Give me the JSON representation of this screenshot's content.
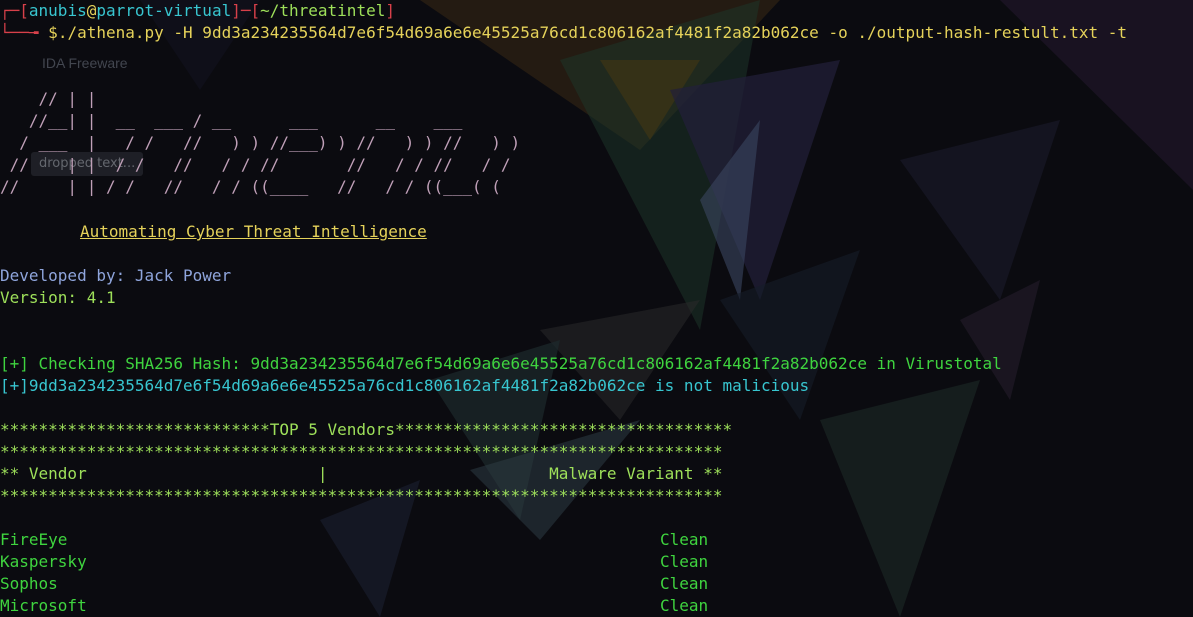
{
  "prompt": {
    "user": "anubis",
    "at": "@",
    "host": "parrot-virtual",
    "directory": "~/threatintel",
    "dollar": "$",
    "command": "./athena.py -H 9dd3a234235564d7e6f54d69a6e6e45525a76cd1c806162af4481f2a82b062ce -o ./output-hash-restult.txt -t"
  },
  "background_windows": {
    "ida_label": "IDA Freeware",
    "dropped_label": "dropped text..."
  },
  "banner": {
    "ascii_lines": [
      "    // | |",
      "   //__| |  __  ___ / __      ___      __    ___",
      "  / ___  |   / /   //   ) ) //___) ) //   ) ) //   ) )",
      " //    | |  / /   //   / / //       //   / / //   / /",
      "//     | | / /   //   / / ((____   //   / / ((___( ("
    ],
    "tagline": "Automating Cyber Threat Intelligence",
    "developer": "Developed by: Jack Power",
    "version": "Version: 4.1"
  },
  "results": {
    "checking": "[+] Checking SHA256 Hash: 9dd3a234235564d7e6f54d69a6e6e45525a76cd1c806162af4481f2a82b062ce in Virustotal",
    "verdict": "[+]9dd3a234235564d7e6f54d69a6e6e45525a76cd1c806162af4481f2a82b062ce is not malicious"
  },
  "vendor_table": {
    "title_line": "****************************TOP 5 Vendors***********************************",
    "separator": "***************************************************************************",
    "header_line": "** Vendor                        |                       Malware Variant **",
    "rows": [
      {
        "vendor": "FireEye",
        "variant": "Clean"
      },
      {
        "vendor": "Kaspersky",
        "variant": "Clean"
      },
      {
        "vendor": "Sophos",
        "variant": "Clean"
      },
      {
        "vendor": "Microsoft",
        "variant": "Clean"
      }
    ]
  },
  "colors": {
    "background": "#0b0b10",
    "prompt_red": "#d7404a",
    "prompt_cyan": "#38c6d0",
    "command_yellow": "#e5d25a",
    "output_green": "#3fd43f",
    "info_cyan": "#38c6d0",
    "developer_lavender": "#8fa5dc",
    "version_green": "#9ee05a"
  }
}
